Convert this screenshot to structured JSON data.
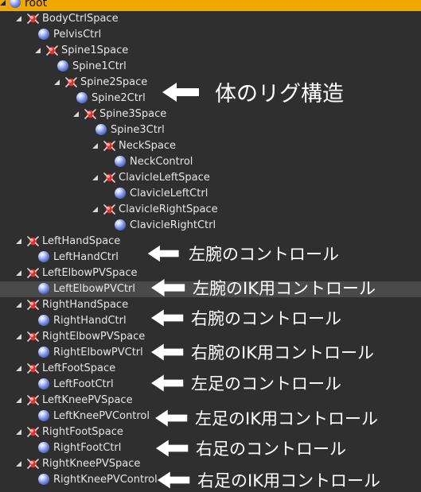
{
  "outliner": {
    "items": [
      {
        "label": "root",
        "icon": "node-ball-icon",
        "indent": 0
      },
      {
        "label": "BodyCtrlSpace",
        "icon": "space-node-icon",
        "indent": 1
      },
      {
        "label": "PelvisCtrl",
        "icon": "node-ball-icon",
        "indent": 2
      },
      {
        "label": "Spine1Space",
        "icon": "space-node-icon",
        "indent": 3
      },
      {
        "label": "Spine1Ctrl",
        "icon": "node-ball-icon",
        "indent": 4
      },
      {
        "label": "Spine2Space",
        "icon": "space-node-icon",
        "indent": 5
      },
      {
        "label": "Spine2Ctrl",
        "icon": "node-ball-icon",
        "indent": 6
      },
      {
        "label": "Spine3Space",
        "icon": "space-node-icon",
        "indent": 7
      },
      {
        "label": "Spine3Ctrl",
        "icon": "node-ball-icon",
        "indent": 8
      },
      {
        "label": "NeckSpace",
        "icon": "space-node-icon",
        "indent": 9
      },
      {
        "label": "NeckControl",
        "icon": "node-ball-icon",
        "indent": 10
      },
      {
        "label": "ClavicleLeftSpace",
        "icon": "space-node-icon",
        "indent": 9
      },
      {
        "label": "ClavicleLeftCtrl",
        "icon": "node-ball-icon",
        "indent": 10
      },
      {
        "label": "ClavicleRightSpace",
        "icon": "space-node-icon",
        "indent": 9
      },
      {
        "label": "ClavicleRightCtrl",
        "icon": "node-ball-icon",
        "indent": 10
      },
      {
        "label": "LeftHandSpace",
        "icon": "space-node-icon",
        "indent": 1
      },
      {
        "label": "LeftHandCtrl",
        "icon": "node-ball-icon",
        "indent": 2
      },
      {
        "label": "LeftElbowPVSpace",
        "icon": "space-node-icon",
        "indent": 1
      },
      {
        "label": "LeftElbowPVCtrl",
        "icon": "node-ball-icon",
        "indent": 2
      },
      {
        "label": "RightHandSpace",
        "icon": "space-node-icon",
        "indent": 1
      },
      {
        "label": "RightHandCtrl",
        "icon": "node-ball-icon",
        "indent": 2
      },
      {
        "label": "RightElbowPVSpace",
        "icon": "space-node-icon",
        "indent": 1
      },
      {
        "label": "RightElbowPVCtrl",
        "icon": "node-ball-icon",
        "indent": 2
      },
      {
        "label": "LeftFootSpace",
        "icon": "space-node-icon",
        "indent": 1
      },
      {
        "label": "LeftFootCtrl",
        "icon": "node-ball-icon",
        "indent": 2
      },
      {
        "label": "LeftKneePVSpace",
        "icon": "space-node-icon",
        "indent": 1
      },
      {
        "label": "LeftKneePVControl",
        "icon": "node-ball-icon",
        "indent": 2
      },
      {
        "label": "RightFootSpace",
        "icon": "space-node-icon",
        "indent": 1
      },
      {
        "label": "RightFootCtrl",
        "icon": "node-ball-icon",
        "indent": 2
      },
      {
        "label": "RightKneePVSpace",
        "icon": "space-node-icon",
        "indent": 1
      },
      {
        "label": "RightKneePVControl",
        "icon": "node-ball-icon",
        "indent": 2
      }
    ],
    "selected_label": "LeftElbowPVCtrl",
    "colors": {
      "background": "#2f2f2f",
      "root_highlight": "#f0a800",
      "selected_row": "#4a4a4a"
    }
  },
  "annotations": [
    {
      "text": "体のリグ構造",
      "arrow_icon": "arrow-left-icon"
    },
    {
      "text": "左腕のコントロール",
      "arrow_icon": "arrow-left-icon"
    },
    {
      "text": "左腕のIK用コントロール",
      "arrow_icon": "arrow-left-icon"
    },
    {
      "text": "右腕のコントロール",
      "arrow_icon": "arrow-left-icon"
    },
    {
      "text": "右腕のIK用コントロール",
      "arrow_icon": "arrow-left-icon"
    },
    {
      "text": "左足のコントロール",
      "arrow_icon": "arrow-left-icon"
    },
    {
      "text": "左足のIK用コントロール",
      "arrow_icon": "arrow-left-icon"
    },
    {
      "text": "右足のコントロール",
      "arrow_icon": "arrow-left-icon"
    },
    {
      "text": "右足のIK用コントロール",
      "arrow_icon": "arrow-left-icon"
    }
  ]
}
